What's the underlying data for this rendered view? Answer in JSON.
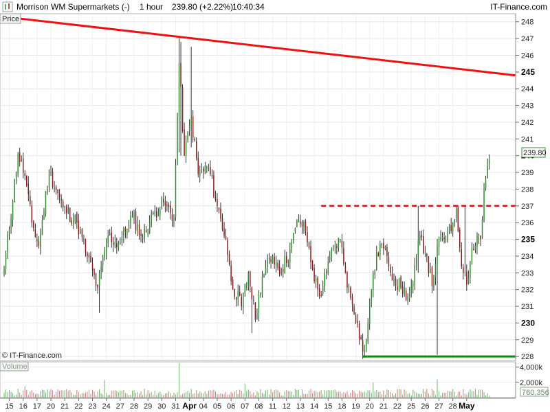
{
  "header": {
    "instrument": "Morrison WM Supermarkets (-)",
    "timeframe": "1 hour",
    "price_change": "239.80 (+2.22%)",
    "time": "10:40:34",
    "source": "IT-Finance.com"
  },
  "labels": {
    "price_panel": "Price",
    "volume_panel": "Volume",
    "copyright": "© IT-Finance.com",
    "last_price_tag": "239.80",
    "last_volume_tag": "760,356"
  },
  "colors": {
    "up_candle": "#2e8b2e",
    "down_candle": "#8b1a1a",
    "resistance_trend": "#ee1111",
    "support_line": "#118811",
    "grid": "#e6e6e6",
    "axis_bg": "#ffffff"
  },
  "chart_data": {
    "type": "candlestick",
    "title": "Morrison WM Supermarkets (-) 1 hour",
    "y_axis": {
      "range": [
        227.8,
        248.4
      ],
      "ticks": [
        228,
        229,
        230,
        231,
        232,
        233,
        234,
        235,
        236,
        237,
        238,
        239,
        240,
        241,
        242,
        243,
        244,
        245,
        246,
        247,
        248
      ],
      "bold_ticks": [
        230,
        235,
        240,
        245
      ]
    },
    "x_axis": {
      "labels": [
        {
          "label": "15",
          "bar": 3
        },
        {
          "label": "16",
          "bar": 11
        },
        {
          "label": "17",
          "bar": 19
        },
        {
          "label": "20",
          "bar": 27
        },
        {
          "label": "21",
          "bar": 35
        },
        {
          "label": "22",
          "bar": 43
        },
        {
          "label": "23",
          "bar": 51
        },
        {
          "label": "24",
          "bar": 59
        },
        {
          "label": "27",
          "bar": 67
        },
        {
          "label": "28",
          "bar": 75
        },
        {
          "label": "29",
          "bar": 83
        },
        {
          "label": "30",
          "bar": 91
        },
        {
          "label": "31",
          "bar": 99
        },
        {
          "label": "Apr",
          "bar": 107,
          "bold": true
        },
        {
          "label": "04",
          "bar": 115
        },
        {
          "label": "05",
          "bar": 123
        },
        {
          "label": "06",
          "bar": 131
        },
        {
          "label": "07",
          "bar": 139
        },
        {
          "label": "08",
          "bar": 147
        },
        {
          "label": "11",
          "bar": 155
        },
        {
          "label": "12",
          "bar": 163
        },
        {
          "label": "13",
          "bar": 171
        },
        {
          "label": "14",
          "bar": 179
        },
        {
          "label": "15",
          "bar": 187
        },
        {
          "label": "18",
          "bar": 195
        },
        {
          "label": "19",
          "bar": 203
        },
        {
          "label": "20",
          "bar": 211
        },
        {
          "label": "21",
          "bar": 219
        },
        {
          "label": "22",
          "bar": 227
        },
        {
          "label": "25",
          "bar": 235
        },
        {
          "label": "26",
          "bar": 243
        },
        {
          "label": "27",
          "bar": 251
        },
        {
          "label": "28",
          "bar": 259
        },
        {
          "label": "May",
          "bar": 267,
          "bold": true
        }
      ]
    },
    "volume_axis": {
      "range": [
        0,
        4600000
      ],
      "ticks": [
        {
          "label": "4,000k",
          "value": 4000000
        },
        {
          "label": "2,000k",
          "value": 2000000
        }
      ],
      "last": 760356
    },
    "key_points": [
      {
        "bar": 0,
        "close": 233.2
      },
      {
        "bar": 8,
        "close": 240.1
      },
      {
        "bar": 12,
        "close": 238.8
      },
      {
        "bar": 16,
        "close": 236.0
      },
      {
        "bar": 20,
        "close": 234.6
      },
      {
        "bar": 26,
        "close": 239.1
      },
      {
        "bar": 34,
        "close": 236.9
      },
      {
        "bar": 42,
        "close": 236.0
      },
      {
        "bar": 48,
        "close": 234.0
      },
      {
        "bar": 54,
        "close": 232.1
      },
      {
        "bar": 60,
        "close": 235.2
      },
      {
        "bar": 66,
        "close": 234.7
      },
      {
        "bar": 74,
        "close": 236.4
      },
      {
        "bar": 80,
        "close": 235.1
      },
      {
        "bar": 86,
        "close": 236.5
      },
      {
        "bar": 92,
        "close": 237.2
      },
      {
        "bar": 98,
        "close": 236.3
      },
      {
        "bar": 101,
        "close": 245.5
      },
      {
        "bar": 104,
        "close": 240.0
      },
      {
        "bar": 108,
        "close": 242.3
      },
      {
        "bar": 112,
        "close": 238.9
      },
      {
        "bar": 118,
        "close": 239.3
      },
      {
        "bar": 123,
        "close": 237.0
      },
      {
        "bar": 128,
        "close": 235.0
      },
      {
        "bar": 131,
        "close": 232.5
      },
      {
        "bar": 137,
        "close": 231.0
      },
      {
        "bar": 141,
        "close": 233.0
      },
      {
        "bar": 145,
        "close": 230.2
      },
      {
        "bar": 149,
        "close": 232.8
      },
      {
        "bar": 155,
        "close": 234.0
      },
      {
        "bar": 160,
        "close": 233.1
      },
      {
        "bar": 165,
        "close": 234.4
      },
      {
        "bar": 170,
        "close": 236.2
      },
      {
        "bar": 174,
        "close": 235.5
      },
      {
        "bar": 178,
        "close": 233.2
      },
      {
        "bar": 182,
        "close": 231.6
      },
      {
        "bar": 186,
        "close": 233.0
      },
      {
        "bar": 190,
        "close": 234.5
      },
      {
        "bar": 194,
        "close": 235.0
      },
      {
        "bar": 197,
        "close": 233.0
      },
      {
        "bar": 200,
        "close": 231.5
      },
      {
        "bar": 204,
        "close": 230.0
      },
      {
        "bar": 207,
        "close": 228.3
      },
      {
        "bar": 209,
        "close": 229.0
      },
      {
        "bar": 213,
        "close": 233.0
      },
      {
        "bar": 217,
        "close": 234.7
      },
      {
        "bar": 221,
        "close": 234.0
      },
      {
        "bar": 225,
        "close": 232.6
      },
      {
        "bar": 229,
        "close": 232.1
      },
      {
        "bar": 233,
        "close": 231.6
      },
      {
        "bar": 236,
        "close": 232.4
      },
      {
        "bar": 240,
        "close": 235.2
      },
      {
        "bar": 244,
        "close": 234.0
      },
      {
        "bar": 247,
        "close": 232.2
      },
      {
        "bar": 250,
        "close": 234.6
      },
      {
        "bar": 254,
        "close": 235.0
      },
      {
        "bar": 258,
        "close": 235.5
      },
      {
        "bar": 261,
        "close": 236.8
      },
      {
        "bar": 263,
        "close": 234.5
      },
      {
        "bar": 265,
        "close": 233.0
      },
      {
        "bar": 267,
        "close": 232.3
      },
      {
        "bar": 270,
        "close": 234.5
      },
      {
        "bar": 273,
        "close": 235.2
      },
      {
        "bar": 275,
        "close": 235.0
      },
      {
        "bar": 277,
        "close": 238.0
      },
      {
        "bar": 279,
        "close": 239.4
      },
      {
        "bar": 280,
        "close": 239.8
      }
    ],
    "spikes": [
      {
        "bar": 101,
        "high": 247.0,
        "low": 240.2
      },
      {
        "bar": 102,
        "high": 246.8,
        "low": 240.0
      },
      {
        "bar": 108,
        "high": 246.5,
        "low": 240.5
      },
      {
        "bar": 239,
        "high": 237.0,
        "low": 233.0
      },
      {
        "bar": 250,
        "high": 234.0,
        "low": 228.1
      },
      {
        "bar": 266,
        "high": 237.0,
        "low": 233.0
      },
      {
        "bar": 55,
        "high": 233.0,
        "low": 230.6
      },
      {
        "bar": 143,
        "high": 231.0,
        "low": 229.4
      }
    ],
    "overlays": [
      {
        "name": "resistance-trendline",
        "style": "solid",
        "color": "#ee1111",
        "x1_bar": 0,
        "y1": 248.3,
        "x2_bar": 295,
        "y2": 244.8
      },
      {
        "name": "neckline",
        "style": "dashed",
        "color": "#dd1111",
        "x1_bar": 183,
        "y1": 237.0,
        "x2_bar": 295,
        "y2": 237.0
      },
      {
        "name": "support-line",
        "style": "solid",
        "color": "#118811",
        "x1_bar": 207,
        "y1": 228.0,
        "x2_bar": 295,
        "y2": 228.0
      }
    ],
    "last_price": 239.8
  }
}
